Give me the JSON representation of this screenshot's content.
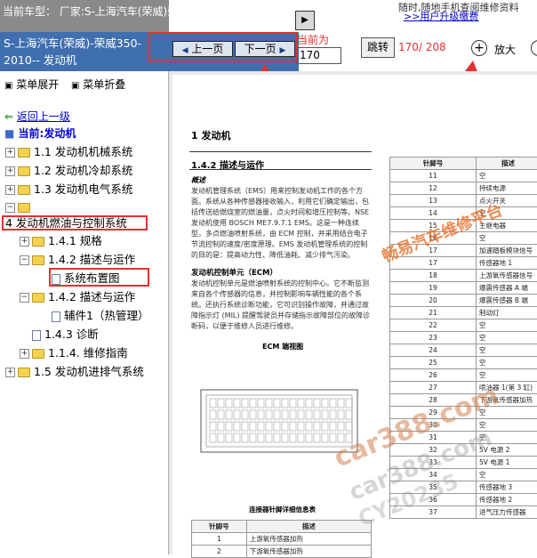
{
  "header": {
    "car_label": "当前车型： 厂家:S-上海汽车(荣威)荣威350-2010-",
    "title": "S-上海汽车(荣威)-荣威350-2010-- 发动机",
    "toggle_icon": "play-icon"
  },
  "nav": {
    "prev_label": "上一页",
    "next_label": "下一页",
    "current_label": "当前为",
    "page_value": "170",
    "jump_label": "跳转",
    "page_count": "170/ 208",
    "zoom_label": "放大"
  },
  "ad": {
    "text": "随时,随地手机查阅维修资料",
    "link": ">>用户升级缴费"
  },
  "sidebar": {
    "expand_all": "菜单展开",
    "collapse_all": "菜单折叠",
    "back": "返回上一级",
    "current": "当前:发动机",
    "items": [
      {
        "label": "1.1 发动机机械系统"
      },
      {
        "label": "1.2 发动机冷却系统"
      },
      {
        "label": "1.3 发动机电气系统"
      },
      {
        "label": ""
      },
      {
        "label": "4 发动机燃油与控制系统"
      },
      {
        "label": "1.4.1 规格"
      },
      {
        "label": "1.4.2 描述与运作"
      },
      {
        "label": "系统布置图"
      },
      {
        "label": "1.4.2 描述与运作"
      },
      {
        "label": "辅件1（热管理）"
      },
      {
        "label": "1.4.3 诊断"
      },
      {
        "label": "1.1.4. 维修指南"
      },
      {
        "label": "1.5 发动机进排气系统"
      }
    ]
  },
  "document": {
    "chapter": "1 发动机",
    "section": "1.4.2 描述与运作",
    "overview_title": "概述",
    "overview_text": "发动机管理系统（EMS）用来控制发动机工作的各个方面。系统从各种传感器接收输入，利用它们确定输出，包括传送给燃烧室的燃油量，点火时间和增压控制等。NSE 发动机使用 BOSCH ME7.9.7.1 EMS。这是一种连续型，多点燃油喷射系统，由 ECM 控制，并采用结合电子节流控制的速度/密度原理。EMS 发动机管理系统的控制的目的是：提高动力性、降低油耗、减少排气污染。",
    "ecm_title": "发动机控制单元（ECM）",
    "ecm_text": "发动机控制单元是燃油喷射系统的控制中心。它不断监测来自各个传感器的信息，并控制影响车辆性能的各个系统。还执行系统诊断功能，它可识别操作故障，并通过故障指示灯 (MIL) 提醒驾驶员并存储指示故障部位的故障诊断码，以便于维修人员进行维修。",
    "diagram_title": "ECM 端视图",
    "connector_title": "连接器针脚详细信息表",
    "table_headers": [
      "针脚号",
      "描述"
    ],
    "bottom_rows": [
      [
        "1",
        "上游氧传感器加热"
      ],
      [
        "2",
        "下游氧传感器加热"
      ]
    ],
    "right_rows": [
      [
        "11",
        "空"
      ],
      [
        "12",
        "持续电源"
      ],
      [
        "13",
        "点火开关"
      ],
      [
        "14",
        "空"
      ],
      [
        "15",
        "主继电器"
      ],
      [
        "16",
        "空"
      ],
      [
        "17",
        "加速踏板模块信号"
      ],
      [
        "17",
        "传感器地 1"
      ],
      [
        "18",
        "上游氧传感器信号"
      ],
      [
        "19",
        "爆震传感器 A 端"
      ],
      [
        "20",
        "爆震传感器 B 端"
      ],
      [
        "21",
        "制动灯"
      ],
      [
        "22",
        "空"
      ],
      [
        "23",
        "空"
      ],
      [
        "24",
        "空"
      ],
      [
        "25",
        "空"
      ],
      [
        "26",
        "空"
      ],
      [
        "27",
        "喷油器 1(第 3 缸)"
      ],
      [
        "28",
        "下游氧传感器加热"
      ],
      [
        "29",
        "空"
      ],
      [
        "30",
        "空"
      ],
      [
        "31",
        "空"
      ],
      [
        "32",
        "5V 电源 2"
      ],
      [
        "33",
        "5V 电源 1"
      ],
      [
        "34",
        "空"
      ],
      [
        "35",
        "传感器地 3"
      ],
      [
        "36",
        "传感器地 2"
      ],
      [
        "37",
        "进气压力传感器"
      ]
    ]
  },
  "watermarks": {
    "brand": "畅易汽车维修平台",
    "site": "car388.com",
    "code": "CY20235"
  },
  "colors": {
    "title_bar": "#3f6fae",
    "highlight_red": "#e53030",
    "folder": "#f3d250",
    "link": "#0000cc"
  }
}
